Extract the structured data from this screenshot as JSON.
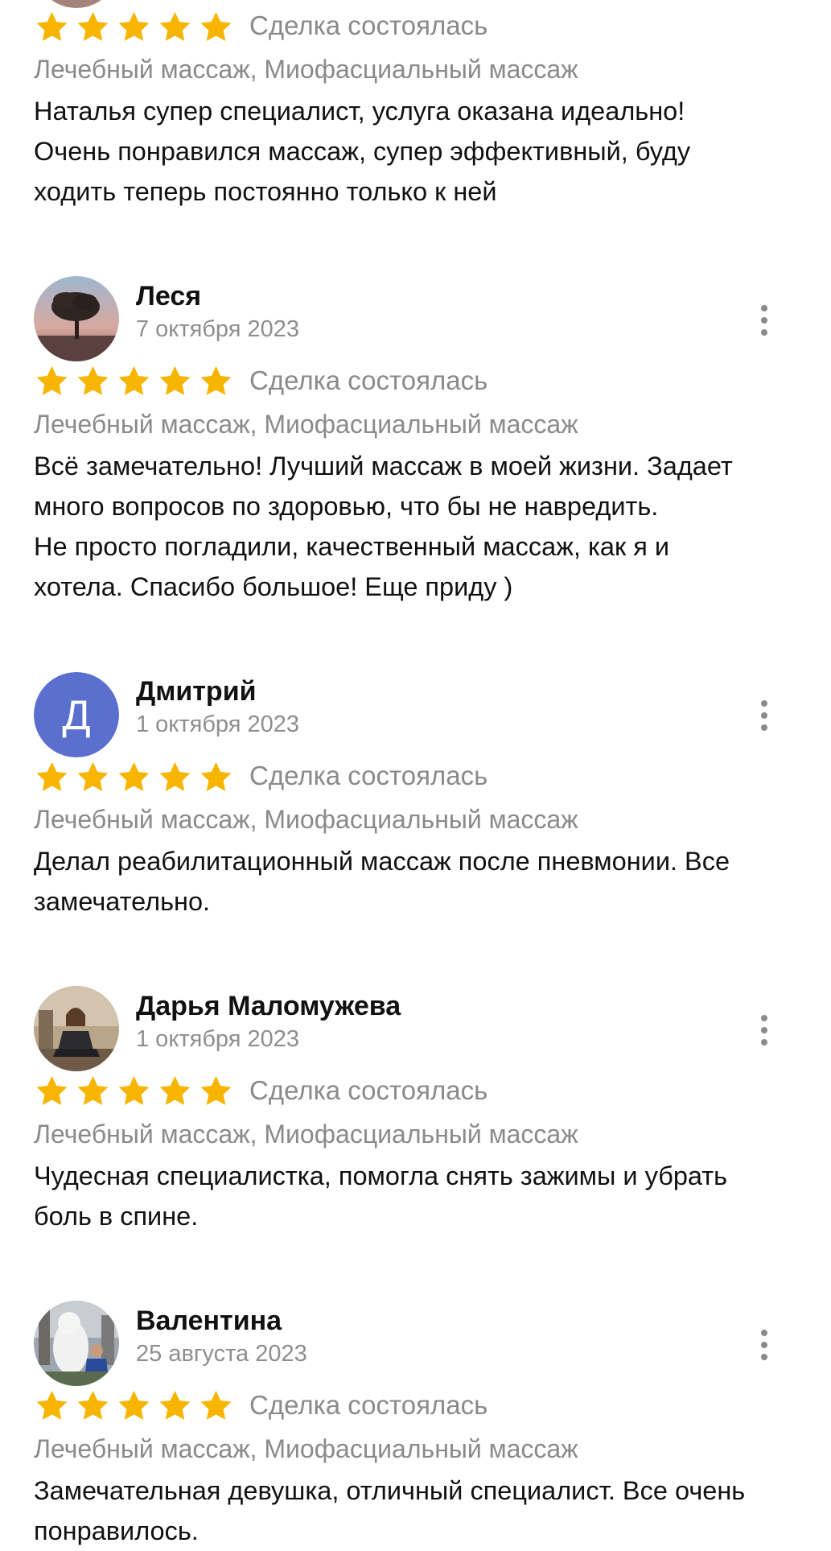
{
  "reviews": [
    {
      "name": "",
      "date": "",
      "rating": 5,
      "deal_status": "Сделка состоялась",
      "services": "Лечебный массаж, Миофасциальный массаж",
      "text": "Наталья супер специалист, услуга оказана идеально!\nОчень понравился массаж, супер эффективный, буду\nходить теперь постоянно только к ней"
    },
    {
      "name": "Леся",
      "date": "7 октября 2023",
      "rating": 5,
      "avatar": "tree-photo",
      "deal_status": "Сделка состоялась",
      "services": "Лечебный массаж, Миофасциальный массаж",
      "text": "Всё замечательно! Лучший массаж в моей жизни.  Задает\nмного вопросов по здоровью, что бы не навредить.\nНе просто погладили, качественный массаж, как я и\nхотела. Спасибо большое! Еще приду )"
    },
    {
      "name": "Дмитрий",
      "date": "1 октября 2023",
      "rating": 5,
      "avatar_letter": "Д",
      "avatar_color": "#5b6fce",
      "deal_status": "Сделка состоялась",
      "services": "Лечебный массаж, Миофасциальный массаж",
      "text": "Делал реабилитационный массаж после пневмонии. Все\nзамечательно."
    },
    {
      "name": "Дарья Маломужева",
      "date": "1 октября 2023",
      "rating": 5,
      "avatar": "person-photo",
      "deal_status": "Сделка состоялась",
      "services": "Лечебный массаж, Миофасциальный массаж",
      "text": "Чудесная специалистка, помогла снять зажимы и убрать\nболь в спине."
    },
    {
      "name": "Валентина",
      "date": "25 августа 2023",
      "rating": 5,
      "avatar": "person-photo",
      "deal_status": "Сделка состоялась",
      "services": "Лечебный массаж, Миофасциальный массаж",
      "text": "Замечательная девушка, отличный специалист. Все очень\nпонравилось."
    }
  ],
  "colors": {
    "star": "#f7b500",
    "muted_text": "#8a8a8a",
    "avatar_dmitry": "#5b6fce"
  },
  "icons": {
    "star": "star-icon",
    "more": "more-vertical-icon"
  }
}
